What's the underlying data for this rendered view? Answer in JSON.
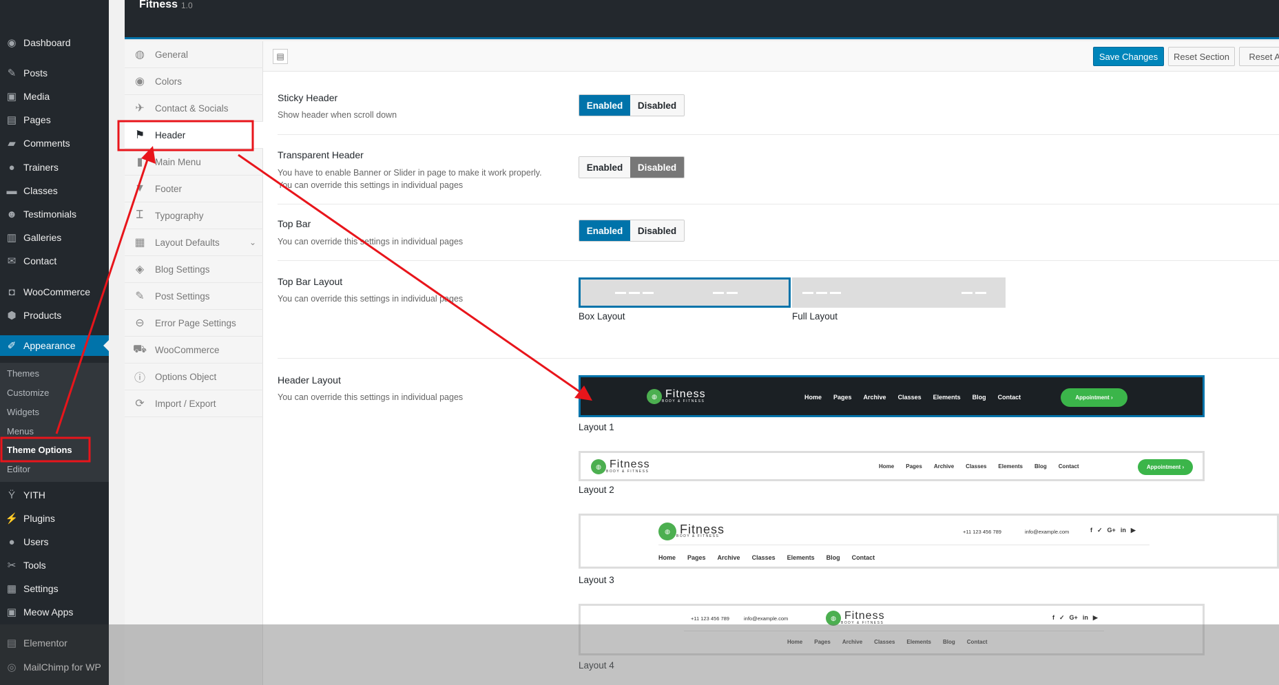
{
  "wp_menu": {
    "items": [
      {
        "label": "Dashboard",
        "icon": "dashboard-icon",
        "glyph": "◉"
      },
      {
        "label": "Posts",
        "icon": "pin-icon",
        "glyph": "✎"
      },
      {
        "label": "Media",
        "icon": "media-icon",
        "glyph": "▣"
      },
      {
        "label": "Pages",
        "icon": "pages-icon",
        "glyph": "▤"
      },
      {
        "label": "Comments",
        "icon": "comments-icon",
        "glyph": "▰"
      },
      {
        "label": "Trainers",
        "icon": "user-icon",
        "glyph": "●"
      },
      {
        "label": "Classes",
        "icon": "folder-icon",
        "glyph": "▬"
      },
      {
        "label": "Testimonials",
        "icon": "testimonial-icon",
        "glyph": "☻"
      },
      {
        "label": "Galleries",
        "icon": "gallery-icon",
        "glyph": "▥"
      },
      {
        "label": "Contact",
        "icon": "mail-icon",
        "glyph": "✉"
      },
      {
        "label": "WooCommerce",
        "icon": "woocommerce-icon",
        "glyph": "◘"
      },
      {
        "label": "Products",
        "icon": "box-icon",
        "glyph": "⬢"
      },
      {
        "label": "Appearance",
        "icon": "brush-icon",
        "glyph": "✐"
      },
      {
        "label": "YITH",
        "icon": "yith-icon",
        "glyph": "Ÿ"
      },
      {
        "label": "Plugins",
        "icon": "plug-icon",
        "glyph": "⚡"
      },
      {
        "label": "Users",
        "icon": "users-icon",
        "glyph": "●"
      },
      {
        "label": "Tools",
        "icon": "wrench-icon",
        "glyph": "✂"
      },
      {
        "label": "Settings",
        "icon": "settings-icon",
        "glyph": "▦"
      },
      {
        "label": "Meow Apps",
        "icon": "meow-icon",
        "glyph": "▣"
      },
      {
        "label": "Elementor",
        "icon": "elementor-icon",
        "glyph": "▤"
      },
      {
        "label": "MailChimp for WP",
        "icon": "mailchimp-icon",
        "glyph": "◎"
      }
    ],
    "submenu": [
      "Themes",
      "Customize",
      "Widgets",
      "Menus",
      "Theme Options",
      "Editor"
    ]
  },
  "header": {
    "title": "Fitness",
    "version": "1.0"
  },
  "options_nav": [
    {
      "label": "General",
      "icon": "globe-icon",
      "glyph": "◍"
    },
    {
      "label": "Colors",
      "icon": "eye-icon",
      "glyph": "◉"
    },
    {
      "label": "Contact & Socials",
      "icon": "twitter-icon",
      "glyph": "✈"
    },
    {
      "label": "Header",
      "icon": "flag-icon",
      "glyph": "⚑"
    },
    {
      "label": "Main Menu",
      "icon": "book-icon",
      "glyph": "▮"
    },
    {
      "label": "Footer",
      "icon": "funnel-icon",
      "glyph": "▼"
    },
    {
      "label": "Typography",
      "icon": "text-height-icon",
      "glyph": "Ꮖ"
    },
    {
      "label": "Layout Defaults",
      "icon": "grid-icon",
      "glyph": "▦"
    },
    {
      "label": "Blog Settings",
      "icon": "tags-icon",
      "glyph": "◈"
    },
    {
      "label": "Post Settings",
      "icon": "edit-icon",
      "glyph": "✎"
    },
    {
      "label": "Error Page Settings",
      "icon": "minus-circle-icon",
      "glyph": "⊖"
    },
    {
      "label": "WooCommerce",
      "icon": "cart-icon",
      "glyph": "⛟"
    },
    {
      "label": "Options Object",
      "icon": "info-icon",
      "glyph": "ⓘ"
    },
    {
      "label": "Import / Export",
      "icon": "refresh-icon",
      "glyph": "⟳"
    }
  ],
  "actions": {
    "save": "Save Changes",
    "reset_section": "Reset Section",
    "reset_all": "Reset All"
  },
  "settings": {
    "sticky": {
      "title": "Sticky Header",
      "desc": "Show header when scroll down",
      "on": "Enabled",
      "off": "Disabled"
    },
    "transparent": {
      "title": "Transparent Header",
      "desc1": "You have to enable Banner or Slider in page to make it work properly.",
      "desc2": "You can override this settings in individual pages",
      "on": "Enabled",
      "off": "Disabled"
    },
    "topbar": {
      "title": "Top Bar",
      "desc": "You can override this settings in individual pages",
      "on": "Enabled",
      "off": "Disabled"
    },
    "topbar_layout": {
      "title": "Top Bar Layout",
      "desc": "You can override this settings in individual pages",
      "box": "Box Layout",
      "full": "Full Layout"
    },
    "header_layout": {
      "title": "Header Layout",
      "desc": "You can override this settings in individual pages",
      "captions": [
        "Layout 1",
        "Layout 2",
        "Layout 3",
        "Layout 4"
      ]
    }
  },
  "preview": {
    "brand": "Fitness",
    "tagline": "BODY & FITNESS",
    "nav": [
      "Home",
      "Pages",
      "Archive",
      "Classes",
      "Elements",
      "Blog",
      "Contact"
    ],
    "button": "Appointment",
    "phone": "+11 123 456 789",
    "email": "info@example.com",
    "socials": [
      "f",
      "✓",
      "G+",
      "in",
      "▶"
    ]
  },
  "colors": {
    "accent": "#0073aa",
    "annotation": "#e8151b",
    "green": "#3bb54a"
  }
}
